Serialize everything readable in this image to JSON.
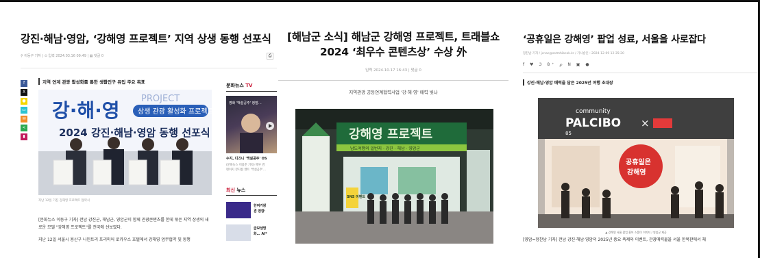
{
  "panel1": {
    "title": "강진·해남·영암, ‘강해영 프로젝트’ 지역 상생 동행 선포식",
    "meta": "⚲ 이동구 기자  |  ⊙ 입력 2024.03.16 09:49  |  ▦ 댓글 0",
    "share_icons": [
      {
        "name": "facebook-icon",
        "glyph": "f",
        "color": "#3b5998"
      },
      {
        "name": "x-icon",
        "glyph": "X",
        "color": "#111111"
      },
      {
        "name": "kakao-icon",
        "glyph": "●",
        "color": "#f7d700"
      },
      {
        "name": "naver-band-icon",
        "glyph": "▭",
        "color": "#2cc3d2"
      },
      {
        "name": "email-icon",
        "glyph": "✉",
        "color": "#f28c28"
      },
      {
        "name": "share-icon",
        "glyph": "<",
        "color": "#2ca94f"
      },
      {
        "name": "bookmark-icon",
        "glyph": "▮",
        "color": "#c2185b"
      }
    ],
    "subhead": "지역 연계 관광 활성화를 통한 생활인구 유입 주요 목표",
    "photo": {
      "banner_main": "강·해·영",
      "banner_project": "PROJECT",
      "banner_sub": "상생 관광 활성화 프로젝트",
      "banner_line": "2024 강진·해남·영암 동행 선포식"
    },
    "caption": "지난 12일 가진 강해영 프로젝트 협약식",
    "body1": "[문화뉴스 이동구 기자] 전남 강진군, 해남군, 영암군이 함께 관광콘텐츠를 한데 묶은 지역 상생의 새로운 모델 \"강해영 프로젝트\"를 전국에 선보였다.",
    "body2": "지난 12일 서울시 용산구 나인트리 프리미어 로카우스 호텔에서 강해영 업무협약 및 동행",
    "sidebar": {
      "tv_title_a": "문화뉴스",
      "tv_title_b": "TV",
      "thumb_text": "영화 '백설공주' 정말…",
      "caption_title": "수지, 디즈니 '백설공주' OS",
      "caption_desc_1": "(문화뉴스 이용준 기자) 배우 겸",
      "caption_desc_2": "편이지 뮤지컬 앤트 '백설공주'…",
      "latest_a": "최신",
      "latest_b": "뉴스",
      "news": [
        {
          "text_1": "한여가왕",
          "text_2": "경 영향·",
          "color": "#3a2a8a"
        },
        {
          "text_1": "금보생명",
          "text_2": "화… AI*",
          "color": "#d8dde8"
        }
      ]
    }
  },
  "panel2": {
    "title_line1": "[해남군 소식] 해남군 강해영 프로젝트, 트래블쇼",
    "title_line2": "2024 ‘최우수 콘텐츠상’ 수상 外",
    "meta": "입력 2024.10.17 16:43  |  댓글 0",
    "subhead": "지역관광 공동연계협력사업 '강·해·영' 매력 빛나",
    "photo": {
      "booth_title": "강해영 프로젝트",
      "booth_sub": "남도여행의 일번지 · 강진 · 해남 · 영암군",
      "sign_text": "SNS 이벤트"
    }
  },
  "panel3": {
    "title": "‘공휴일은 강해영’ 팝업 성료, 서울을 사로잡다",
    "meta": "정찬남 기자 / jcnac@sotmhibcok.kr / 기사승인 : 2024-12-09 12:35:20",
    "share_glyphs": "f ♥ ℑ 8⁺ ℘ N ▣ ●",
    "subhead": "강진·해남·영암 매력을 담은 2025년 여행 초대장",
    "photo": {
      "sign_community": "community",
      "sign_palcibo": "PALCIBO",
      "sign_x": "×",
      "sign_number": "85",
      "badge_line1": "공휴일은",
      "badge_line2": "강해영"
    },
    "caption": "▲ 강해영 서울 팝업 홍보 소품이 이미지 / 영암군 제공",
    "body": "[영암=정찬남 기자] 전남 강진·해남·영암의 2025년 중요 축제와 이벤트, 관광매력물을 서울 한복판에서 체"
  }
}
